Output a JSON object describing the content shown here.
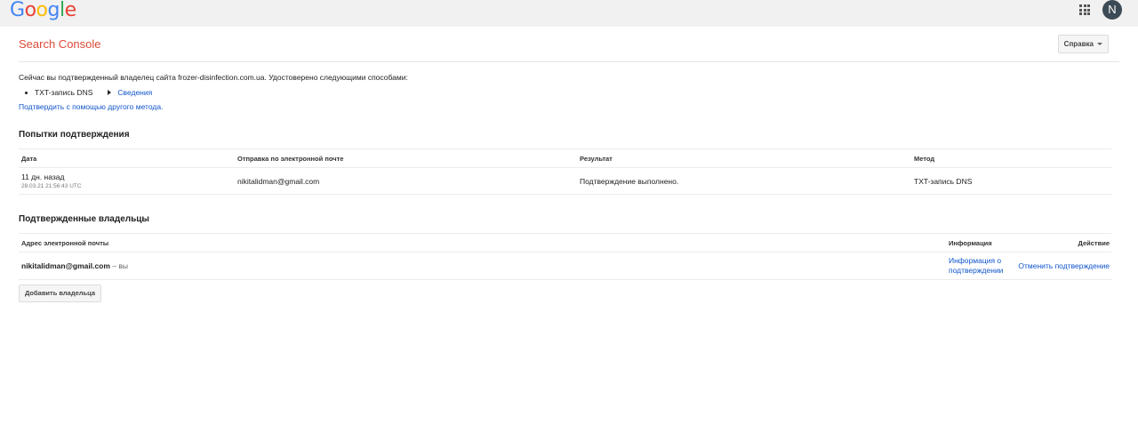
{
  "topbar": {
    "logo_letters": [
      {
        "char": "G",
        "color": "#4285f4"
      },
      {
        "char": "o",
        "color": "#ea4335"
      },
      {
        "char": "o",
        "color": "#fbbc05"
      },
      {
        "char": "g",
        "color": "#4285f4"
      },
      {
        "char": "l",
        "color": "#34a853"
      },
      {
        "char": "e",
        "color": "#ea4335"
      }
    ],
    "avatar_initial": "N"
  },
  "header": {
    "product_name": "Search Console",
    "help_label": "Справка"
  },
  "intro": {
    "text": "Сейчас вы подтвержденный владелец сайта frozer-disinfection.com.ua. Удостоверено следующими способами:",
    "method": "TXT-запись DNS",
    "details_link": "Сведения",
    "alt_method_link": "Подтвердить с помощью другого метода."
  },
  "attempts": {
    "heading": "Попытки подтверждения",
    "columns": [
      "Дата",
      "Отправка по электронной почте",
      "Результат",
      "Метод"
    ],
    "rows": [
      {
        "date": "11 дн. назад",
        "timestamp": "28.03.21 21:56:43 UTC",
        "email": "nikitalidman@gmail.com",
        "result": "Подтверждение выполнено.",
        "method": "TXT-запись DNS"
      }
    ]
  },
  "owners": {
    "heading": "Подтвержденные владельцы",
    "columns": [
      "Адрес электронной почты",
      "Информация",
      "Действие"
    ],
    "rows": [
      {
        "email": "nikitalidman@gmail.com",
        "you": " – вы",
        "info_link": "Информация о подтверждении",
        "action_link": "Отменить подтверждение"
      }
    ],
    "add_button": "Добавить владельца"
  }
}
